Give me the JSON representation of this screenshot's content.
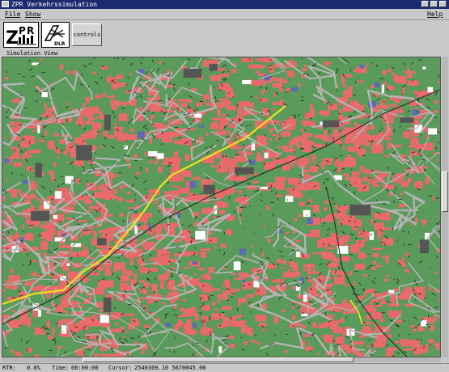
{
  "window": {
    "title": "ZPR Verkehrssimulation"
  },
  "menu": {
    "file": "File",
    "show": "Show",
    "help": "Help"
  },
  "toolbar": {
    "zpr_logo_text": "ZPR",
    "dlr_logo_text": "DLR",
    "controls_label": "controls"
  },
  "main": {
    "section_label": "Simulation View"
  },
  "status": {
    "rtr": "RTR:",
    "rtr_value": "0.0%",
    "time_label": "Time:",
    "time_value": "00:00:00",
    "cursor_label": "Cursor:",
    "cursor_value": "2540309.10 5670045.00"
  },
  "colors": {
    "forest": "#5a9a5a",
    "urban": "#e86a6a",
    "road": "#b4b4b4",
    "building": "#1a1a1a",
    "highlight": "#f0e020",
    "water": "#5a6ab4",
    "open": "#ffffff",
    "titlebar": "#1e2a6e"
  },
  "icons": {
    "system_menu": "window-menu-icon",
    "minimize": "minimize-icon",
    "maximize": "maximize-icon",
    "close": "close-icon"
  }
}
